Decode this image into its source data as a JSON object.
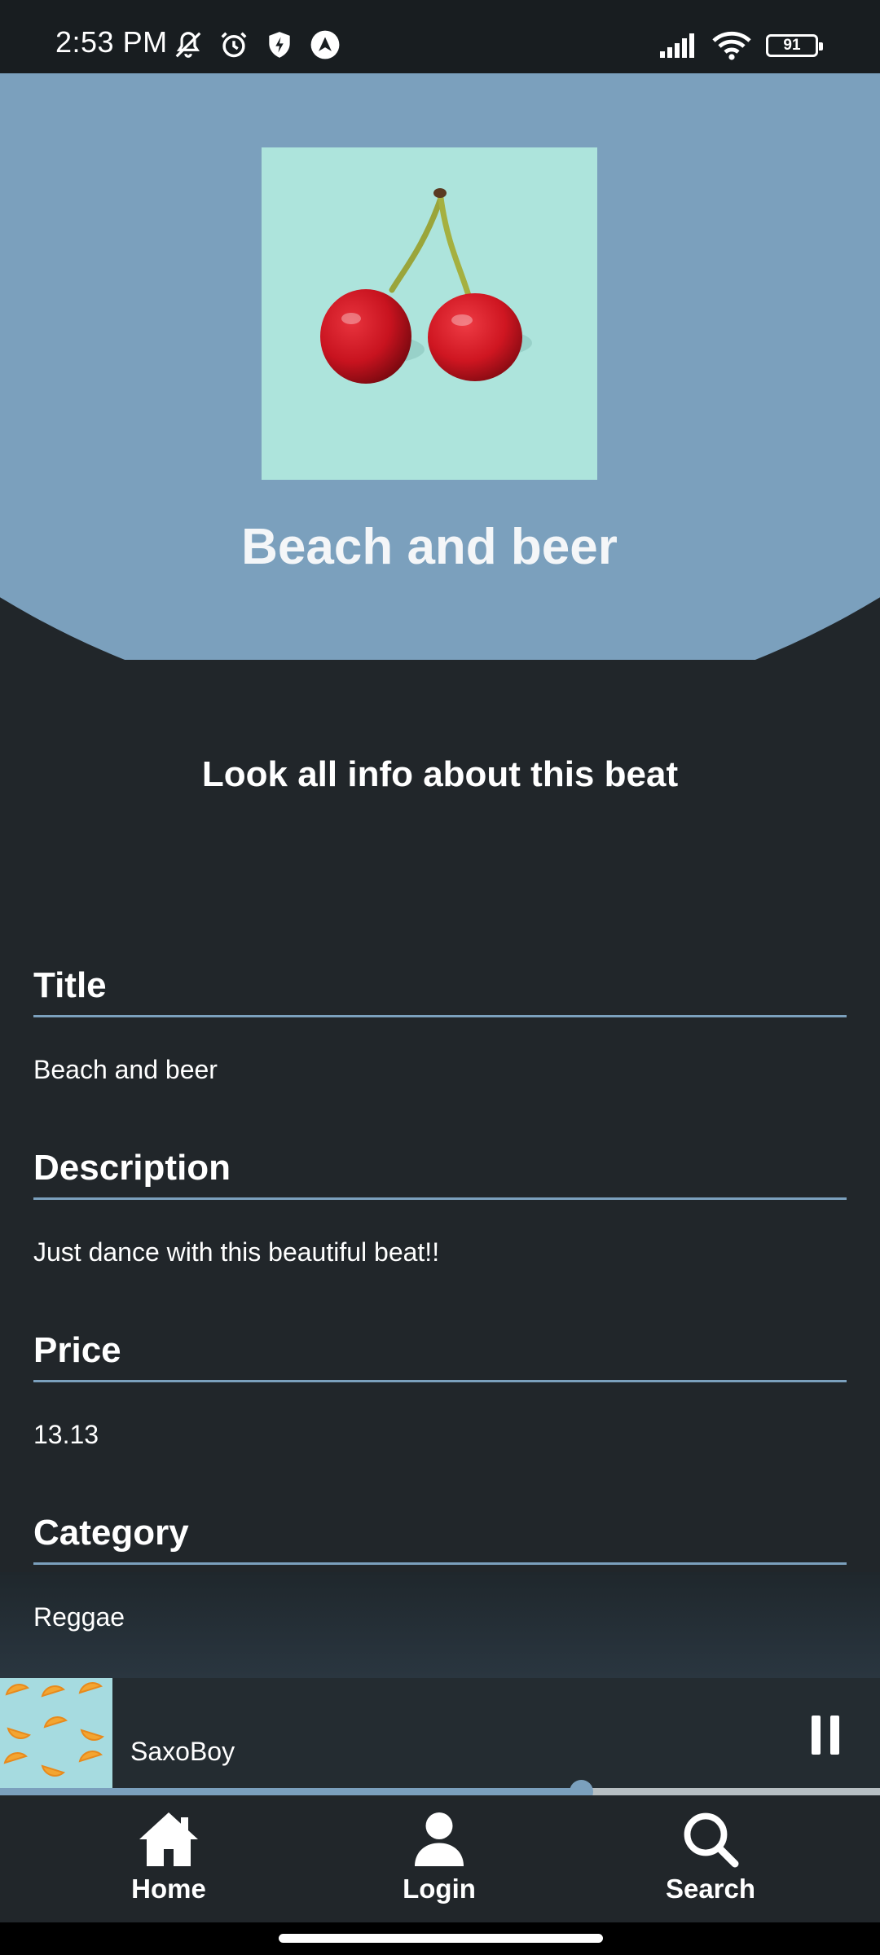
{
  "status_bar": {
    "time": "2:53 PM",
    "battery": "91",
    "left_icons": [
      "mute-icon",
      "alarm-icon",
      "shield-icon",
      "nav-app-icon"
    ],
    "right_icons": [
      "signal-icon",
      "wifi-icon",
      "battery-icon"
    ]
  },
  "header": {
    "title": "Beach and beer",
    "cover_image": "cherries-cover",
    "accent_color": "#7ba0bd"
  },
  "subtitle": "Look all info about this beat",
  "info": [
    {
      "label": "Title",
      "value": "Beach and beer"
    },
    {
      "label": "Description",
      "value": "Just dance with this beautiful beat!!"
    },
    {
      "label": "Price",
      "value": "13.13"
    },
    {
      "label": "Category",
      "value": "Reggae"
    }
  ],
  "player": {
    "track": "SaxoBoy",
    "art": "orange-slices-art",
    "state": "playing",
    "progress": 0.66
  },
  "nav": [
    {
      "label": "Home",
      "icon": "home-icon"
    },
    {
      "label": "Login",
      "icon": "user-icon"
    },
    {
      "label": "Search",
      "icon": "search-icon"
    }
  ]
}
